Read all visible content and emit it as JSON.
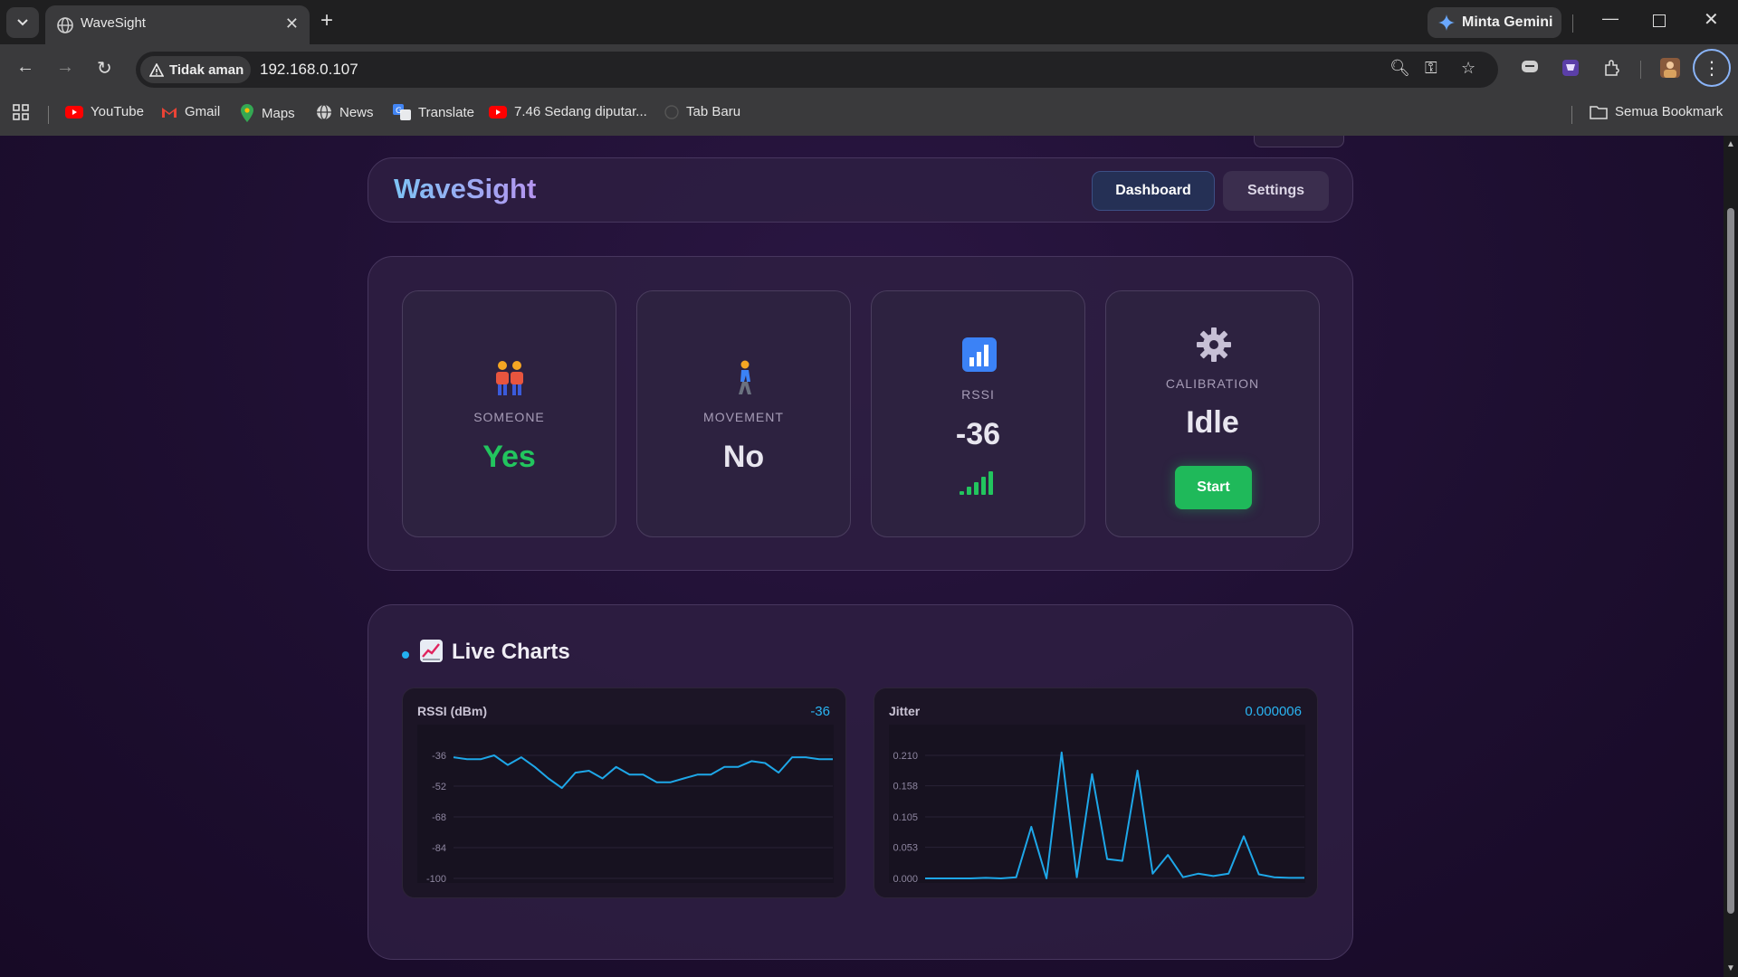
{
  "browser": {
    "tab_title": "WaveSight",
    "gemini_label": "Minta Gemini",
    "security_chip": "Tidak aman",
    "url": "192.168.0.107",
    "bookmarks": [
      {
        "label": "YouTube",
        "icon": "youtube-icon"
      },
      {
        "label": "Gmail",
        "icon": "gmail-icon"
      },
      {
        "label": "Maps",
        "icon": "maps-icon"
      },
      {
        "label": "News",
        "icon": "news-icon"
      },
      {
        "label": "Translate",
        "icon": "translate-icon"
      },
      {
        "label": "7.46 Sedang diputar...",
        "icon": "youtube-icon"
      },
      {
        "label": "Tab Baru",
        "icon": "globe-icon"
      }
    ],
    "all_bookmarks": "Semua Bookmark"
  },
  "header": {
    "brand": "WaveSight",
    "nav": {
      "dashboard": "Dashboard",
      "settings": "Settings"
    }
  },
  "cards": {
    "someone": {
      "label": "SOMEONE",
      "value": "Yes",
      "icon": "people-icon",
      "value_color": "#22c55e"
    },
    "movement": {
      "label": "MOVEMENT",
      "value": "No",
      "icon": "walking-person-icon"
    },
    "rssi": {
      "label": "RSSI",
      "value": "-36",
      "icon": "bar-chart-icon",
      "signal_icon": "signal-strength-icon",
      "signal_color": "#22c55e"
    },
    "calibration": {
      "label": "CALIBRATION",
      "value": "Idle",
      "icon": "gear-icon",
      "button": "Start",
      "button_color": "#1fb95a"
    }
  },
  "live_charts": {
    "title": "Live Charts",
    "icon": "chart-increasing-icon"
  },
  "chart_data": [
    {
      "type": "line",
      "title": "RSSI (dBm)",
      "current": "-36",
      "ylim": [
        -100,
        -36
      ],
      "yticks": [
        "-36",
        "-52",
        "-68",
        "-84",
        "-100"
      ],
      "grid": true,
      "color": "#1ea7e8",
      "series": [
        {
          "values": [
            -37,
            -38,
            -38,
            -36,
            -41,
            -37,
            -42,
            -48,
            -53,
            -45,
            -44,
            -48,
            -42,
            -46,
            -46,
            -50,
            -50,
            -48,
            -46,
            -46,
            -42,
            -42,
            -39,
            -40,
            -45,
            -37,
            -37,
            -38,
            -38
          ]
        }
      ]
    },
    {
      "type": "line",
      "title": "Jitter",
      "current": "0.000006",
      "ylim": [
        0,
        0.21
      ],
      "yticks": [
        "0.210",
        "0.158",
        "0.105",
        "0.053",
        "0.000"
      ],
      "grid": true,
      "color": "#1ea7e8",
      "series": [
        {
          "values": [
            0.0,
            0.0,
            0.0,
            0.0,
            0.001,
            0.0,
            0.002,
            0.088,
            0.0,
            0.215,
            0.002,
            0.178,
            0.033,
            0.03,
            0.184,
            0.008,
            0.04,
            0.002,
            0.008,
            0.004,
            0.008,
            0.072,
            0.007,
            0.002,
            0.001,
            0.001
          ]
        }
      ]
    }
  ]
}
